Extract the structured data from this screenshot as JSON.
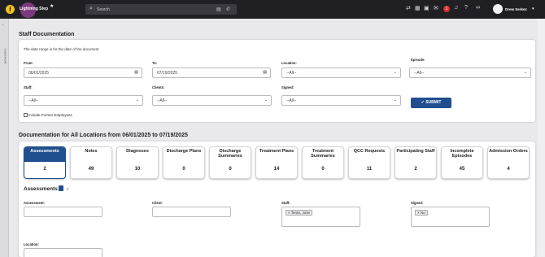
{
  "topbar": {
    "logo_letter": "f",
    "brand": "Lightning Step",
    "favorite_icon": "star-icon",
    "search_placeholder": "Search",
    "search_icons": [
      "calendar-icon",
      "phone-icon"
    ],
    "icons": [
      "shuffle-icon",
      "calendar-icon",
      "grid-icon",
      "chat-icon",
      "bell-icon",
      "help-icon",
      "link-icon"
    ],
    "notification_count": "1",
    "user_name": "Drew Serkez"
  },
  "sidebar": {
    "label": "WORKSPACE"
  },
  "staff_doc": {
    "title": "Staff Documentation",
    "note": "The date range is for the date of the document",
    "from_label": "From:",
    "from_value": "06/01/2025",
    "to_label": "To:",
    "to_value": "07/19/2025",
    "location_label": "Location:",
    "location_value": "--All--",
    "episode_label": "Episode:",
    "episode_value": "--All--",
    "staff_label": "Staff:",
    "staff_value": "--All--",
    "clients_label": "Clients:",
    "clients_value": "--All--",
    "signed_label": "Signed:",
    "signed_value": "--All--",
    "include_former_label": "Include Former Employees",
    "submit_label": "SUBMIT"
  },
  "summary": {
    "title": "Documentation for All Locations from 06/01/2025 to 07/19/2025",
    "tiles": [
      {
        "name": "Assessments",
        "count": "2",
        "active": true
      },
      {
        "name": "Notes",
        "count": "49"
      },
      {
        "name": "Diagnoses",
        "count": "10"
      },
      {
        "name": "Discharge Plans",
        "count": "0"
      },
      {
        "name": "Discharge Summaries",
        "count": "0"
      },
      {
        "name": "Treatment Plans",
        "count": "14"
      },
      {
        "name": "Treatment Summaries",
        "count": "0"
      },
      {
        "name": "QCC Requests",
        "count": "11"
      },
      {
        "name": "Participating Staff",
        "count": "2"
      },
      {
        "name": "Incomplete Episodes",
        "count": "45"
      },
      {
        "name": "Admission Orders",
        "count": "4"
      }
    ]
  },
  "assessments": {
    "title": "Assessments",
    "count": "2",
    "assessment_label": "Assessment:",
    "client_label": "Client:",
    "staff_label": "Staff:",
    "staff_tag": "× Teran, Jose",
    "signed_label": "Signed:",
    "signed_tag": "× No",
    "location_label": "Location:"
  }
}
